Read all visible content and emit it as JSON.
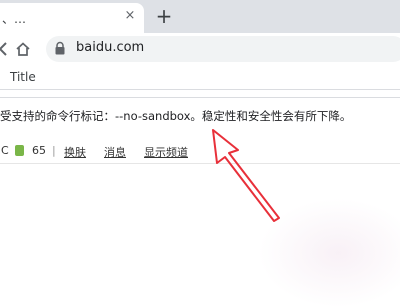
{
  "tab": {
    "title": "、…",
    "close_glyph": "×",
    "new_tab_glyph": "+"
  },
  "toolbar": {
    "url": "baidu.com"
  },
  "bookmarks": {
    "items": [
      {
        "label": "Title"
      }
    ]
  },
  "infobar": {
    "message": "受支持的命令行标记：--no-sandbox。稳定性和安全性会有所下降。"
  },
  "page": {
    "nav": {
      "left_fragment": "C",
      "count": "65",
      "separator": "|",
      "links": [
        "换肤",
        "消息",
        "显示频道"
      ]
    }
  },
  "annotation": {
    "arrow_color": "#e8303a"
  },
  "icons": [
    "back-icon",
    "home-icon",
    "lock-icon",
    "close-icon",
    "plus-icon"
  ]
}
